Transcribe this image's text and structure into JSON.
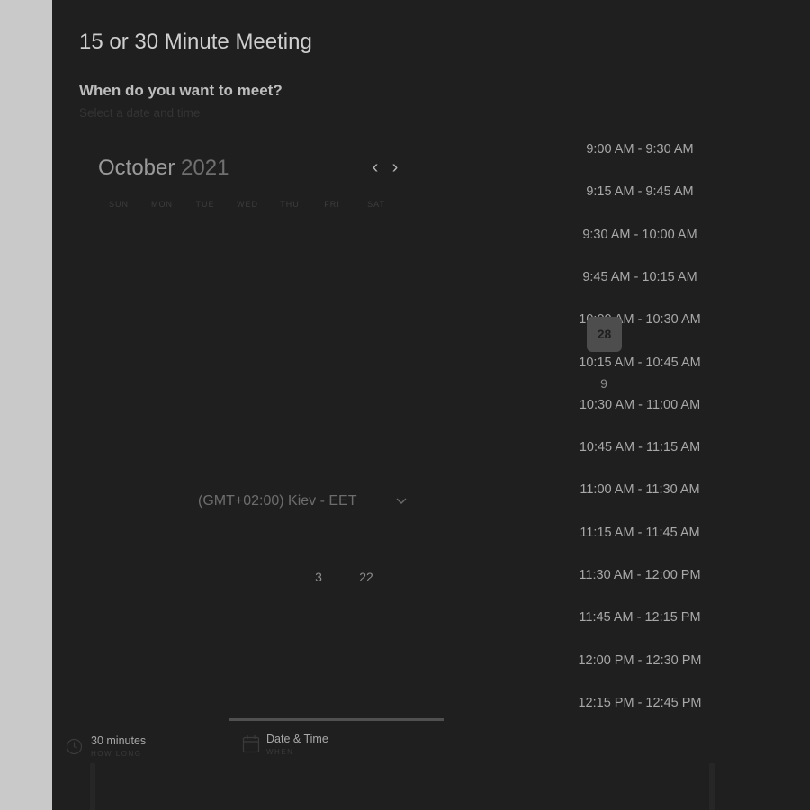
{
  "meeting": {
    "title": "15 or 30 Minute Meeting",
    "subtitle": "When do you want to meet?",
    "hint": "Select a date and time"
  },
  "calendar": {
    "month": "October",
    "year": "2021",
    "weekdays": [
      "SUN",
      "MON",
      "TUE",
      "WED",
      "THU",
      "FRI",
      "SAT"
    ],
    "visible_days": [
      "3",
      "22"
    ],
    "selected_day": "28",
    "extra_day": "9"
  },
  "timezone": {
    "label": "(GMT+02:00) Kiev - EET"
  },
  "slots": [
    "9:00 AM - 9:30 AM",
    "9:15 AM - 9:45 AM",
    "9:30 AM - 10:00 AM",
    "9:45 AM - 10:15 AM",
    "10:00 AM - 10:30 AM",
    "10:15 AM - 10:45 AM",
    "10:30 AM - 11:00 AM",
    "10:45 AM - 11:15 AM",
    "11:00 AM - 11:30 AM",
    "11:15 AM - 11:45 AM",
    "11:30 AM - 12:00 PM",
    "11:45 AM - 12:15 PM",
    "12:00 PM - 12:30 PM",
    "12:15 PM - 12:45 PM"
  ],
  "footer": {
    "duration": "30 minutes",
    "duration_sub": "HOW LONG",
    "datetime": "Date & Time",
    "datetime_sub": "WHEN"
  },
  "icons": {
    "prev": "chevron-left-icon",
    "next": "chevron-right-icon",
    "timezone": "chevron-down-icon",
    "duration": "clock-icon",
    "datetime": "calendar-icon"
  },
  "colors": {
    "panel_bg": "#1f1f1f",
    "page_bg": "#c9c9c9",
    "selected_day_bg": "#4d4d4d",
    "progress_line": "#505050"
  }
}
